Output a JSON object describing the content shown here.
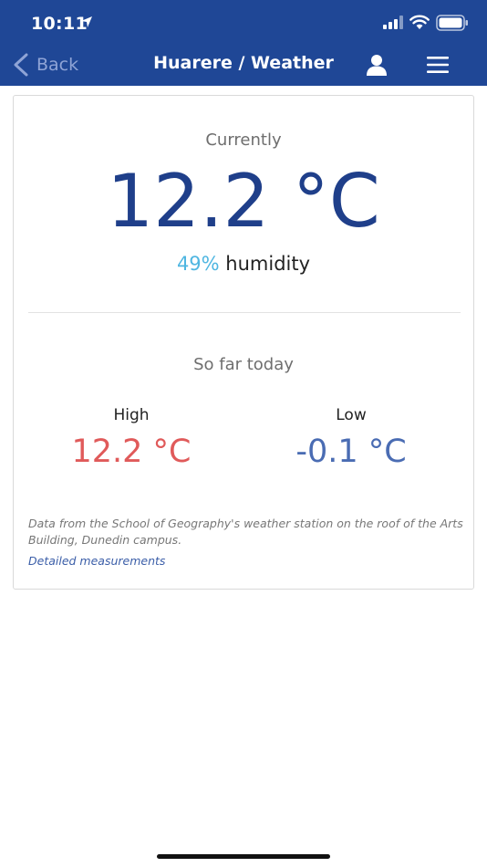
{
  "status_bar": {
    "time": "10:11",
    "icons": [
      "location-arrow-icon",
      "signal-icon",
      "wifi-icon",
      "battery-icon"
    ]
  },
  "nav": {
    "back_label": "Back",
    "title": "Huarere / Weather",
    "icons": [
      "chevron-left-icon",
      "user-icon",
      "hamburger-menu-icon"
    ]
  },
  "weather": {
    "currently_label": "Currently",
    "current_temp": "12.2 °C",
    "humidity_value": "49%",
    "humidity_label": " humidity",
    "so_far_today_label": "So far today",
    "high_label": "High",
    "high_value": "12.2 °C",
    "low_label": "Low",
    "low_value": "-0.1 °C",
    "source_note": "Data from the School of Geography's weather station on the roof of the Arts Building, Dunedin campus.",
    "detail_link": "Detailed measurements"
  },
  "colors": {
    "brand_blue": "#1f4796",
    "temp_blue": "#1f3f8a",
    "humidity_cyan": "#4fb6e1",
    "high_red": "#e05a5a",
    "low_blue": "#4a6cb3",
    "link_blue": "#3b5ea8"
  }
}
